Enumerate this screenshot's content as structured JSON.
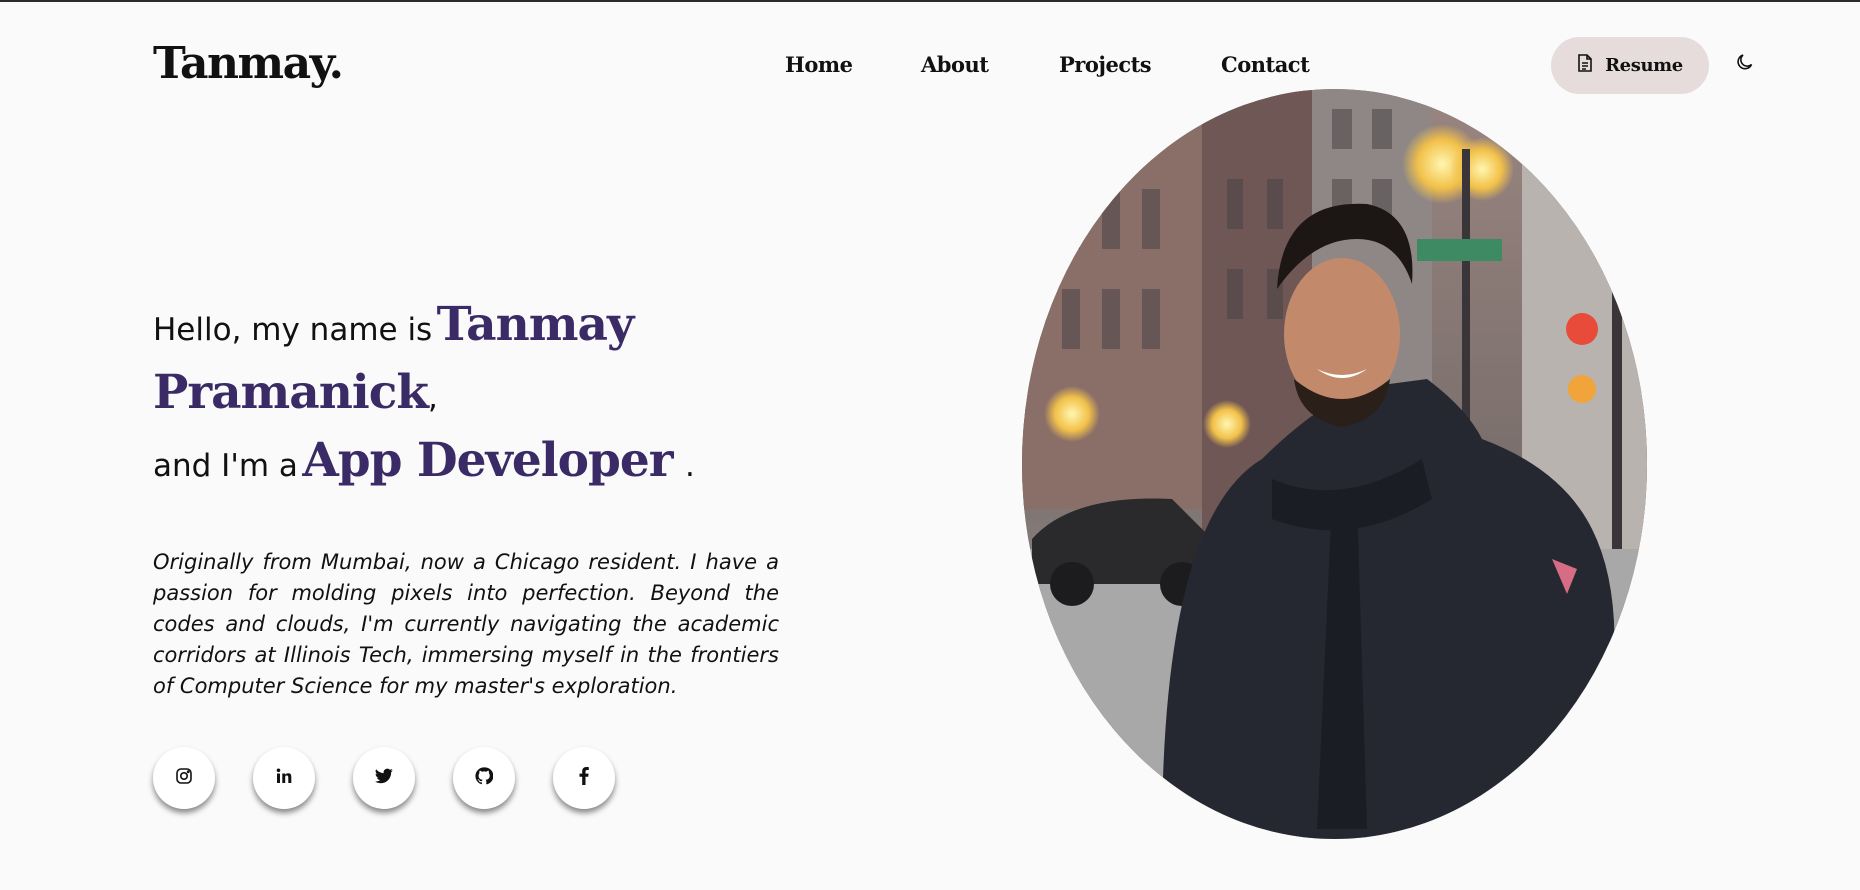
{
  "brand": {
    "logo": "Tanmay."
  },
  "nav": {
    "items": [
      "Home",
      "About",
      "Projects",
      "Contact"
    ]
  },
  "header": {
    "resume_label": "Resume",
    "theme_icon": "moon-icon"
  },
  "hero": {
    "greeting_prefix": "Hello, my name is",
    "name_first": "Tanmay",
    "name_last": "Pramanick",
    "comma": ",",
    "role_prefix": "and I'm a",
    "role": "App Developer",
    "period": ".",
    "bio": "Originally from Mumbai, now a Chicago resident. I have a passion for molding pixels into perfection. Beyond the codes and clouds, I'm currently navigating the academic corridors at Illinois Tech, immersing myself in the frontiers of Computer Science for my master's exploration."
  },
  "socials": [
    {
      "icon": "instagram-icon"
    },
    {
      "icon": "linkedin-icon"
    },
    {
      "icon": "twitter-icon"
    },
    {
      "icon": "github-icon"
    },
    {
      "icon": "facebook-icon"
    }
  ],
  "colors": {
    "accent": "#3a2a66",
    "resume_bg": "#e7dcdc",
    "page_bg": "#fafafa"
  }
}
